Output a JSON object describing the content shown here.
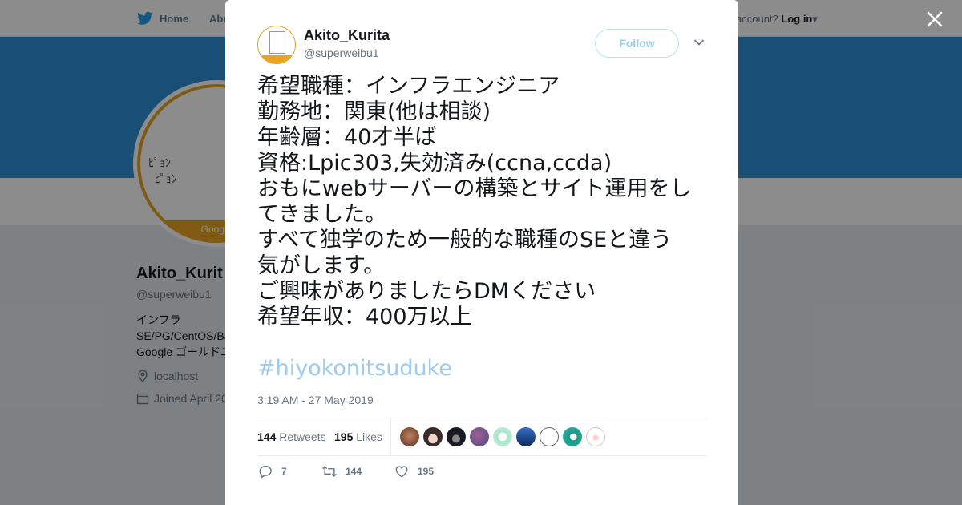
{
  "topbar": {
    "home_label": "Home",
    "about_label": "Abo",
    "account_prompt": "account?",
    "login_label": "Log in"
  },
  "profile": {
    "name": "Akito_Kurit",
    "handle": "@superweibu1",
    "bio": "インフラ\nSE/PG/CentOS/Ba\nGoogle ゴールドユ",
    "location": "localhost",
    "joined": "Joined April 20",
    "avatar_band": "Google",
    "avatar_art": "ﾋﾟｮﾝ\n  ﾋﾟｮﾝ"
  },
  "tweet": {
    "author_name": "Akito_Kurita",
    "author_handle": "@superweibu1",
    "follow_label": "Follow",
    "lines": [
      "希望職種：インフラエンジニア",
      "勤務地：関東(他は相談)",
      "年齢層：40才半ば",
      "資格:Lpic303,失効済み(ccna,ccda)",
      "おもにwebサーバーの構築とサイト運用をし",
      "てきました。",
      "すべて独学のため一般的な職種のSEと違う",
      "気がします。",
      "ご興味がありましたらDMください",
      "希望年収：400万以上"
    ],
    "hashtag": "#hiyokonitsuduke",
    "timestamp": "3:19 AM - 27 May 2019",
    "retweets_count": "144",
    "retweets_label": "Retweets",
    "likes_count": "195",
    "likes_label": "Likes",
    "reply_count": "7",
    "retweet_action_count": "144",
    "like_action_count": "195"
  },
  "colors": {
    "twitter_blue": "#1da1f2",
    "banner": "#2e8ed6",
    "avatar_accent": "#e9a421",
    "follow_text": "#9cccef"
  },
  "icons": [
    "twitter-bird-icon",
    "close-icon",
    "chevron-down-icon",
    "reply-icon",
    "retweet-icon",
    "heart-icon",
    "location-icon",
    "calendar-icon"
  ]
}
